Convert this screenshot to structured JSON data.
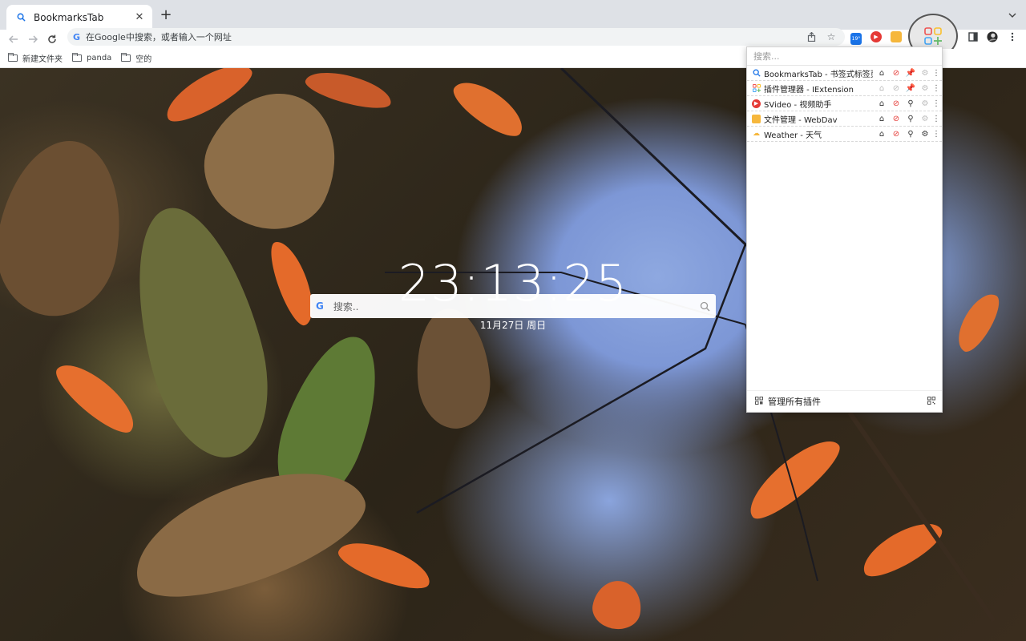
{
  "tab": {
    "title": "BookmarksTab",
    "close": "✕",
    "new_tab": "+"
  },
  "omnibox": {
    "placeholder": "在Google中搜索，或者输入一个网址"
  },
  "extensions_bar": {
    "weather_temp": "19°"
  },
  "bookmarks": [
    {
      "label": "新建文件夹"
    },
    {
      "label": "panda"
    },
    {
      "label": "空的"
    }
  ],
  "newtab": {
    "time": "23:13:25",
    "date": "11月27日 周日",
    "search_placeholder": "搜索.."
  },
  "popup": {
    "search_placeholder": "搜索...",
    "extensions": [
      {
        "name": "BookmarksTab - 书签式标签页",
        "icon": "search-icon",
        "home_enabled": true,
        "pinned": true,
        "settings_enabled": false
      },
      {
        "name": "插件管理器 - IExtension",
        "icon": "grid-plus-icon",
        "home_enabled": false,
        "pinned": true,
        "settings_enabled": false
      },
      {
        "name": "SVideo - 视频助手",
        "icon": "play-icon",
        "home_enabled": true,
        "pinned": false,
        "settings_enabled": false
      },
      {
        "name": "文件管理 - WebDav",
        "icon": "folder-icon",
        "home_enabled": true,
        "pinned": false,
        "settings_enabled": false
      },
      {
        "name": "Weather - 天气",
        "icon": "weather-icon",
        "home_enabled": true,
        "pinned": false,
        "settings_enabled": true
      }
    ],
    "footer_label": "管理所有插件"
  },
  "colors": {
    "pin_active": "#e53935",
    "disable_icon": "#e53935",
    "accent_blue": "#1a73e8"
  }
}
